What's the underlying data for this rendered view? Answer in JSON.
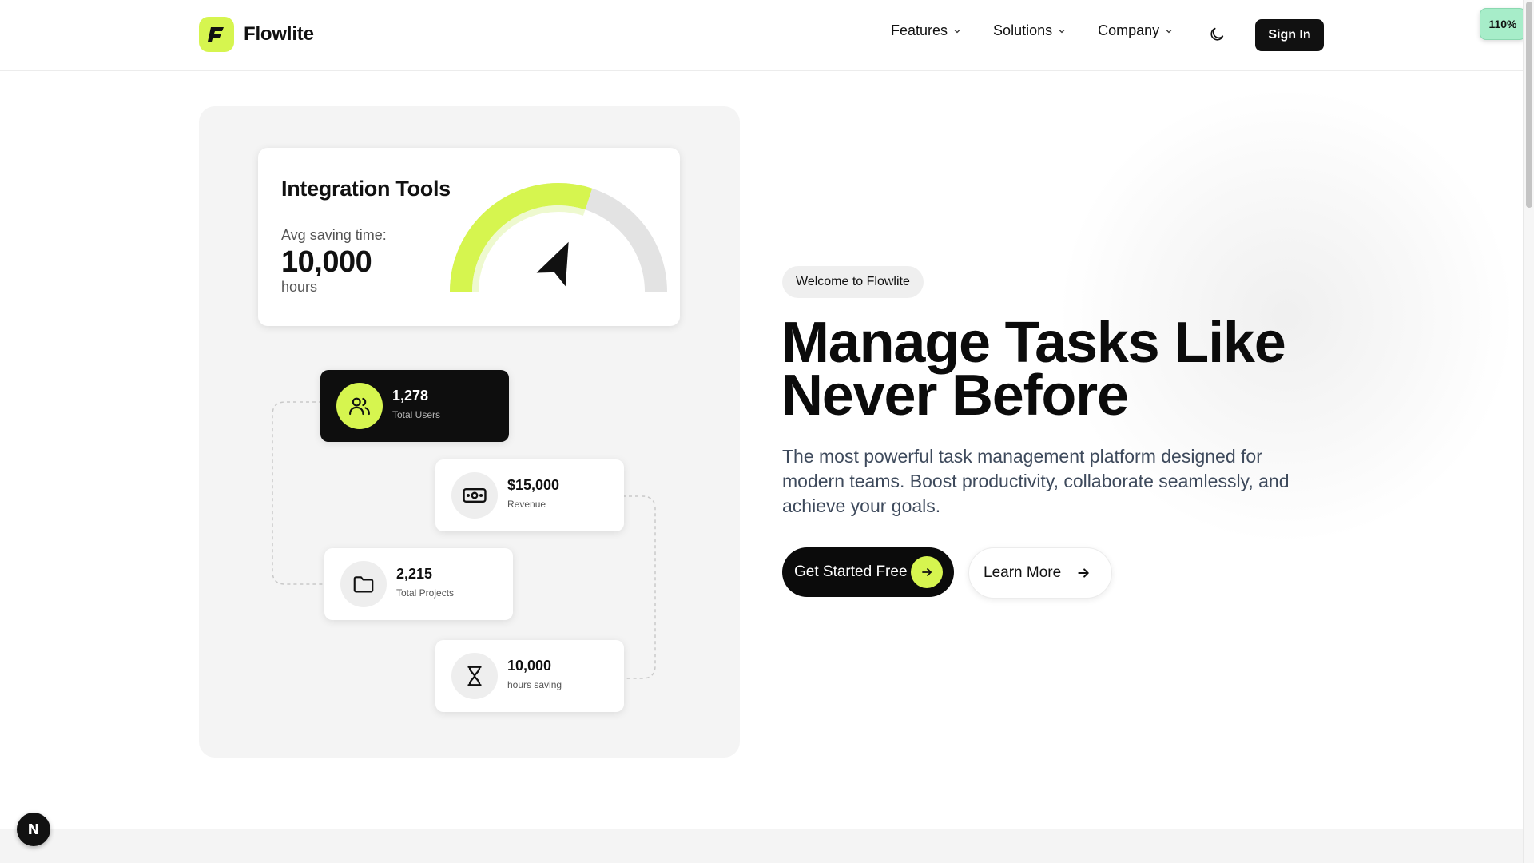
{
  "brand": {
    "name": "Flowlite",
    "accent": "#d6f54f",
    "logo_icon": "flowlite-logo-icon"
  },
  "nav": {
    "items": [
      {
        "label": "Features",
        "icon": "chevron-down-icon"
      },
      {
        "label": "Solutions",
        "icon": "chevron-down-icon"
      },
      {
        "label": "Company",
        "icon": "chevron-down-icon"
      }
    ],
    "theme_icon": "moon-icon",
    "signin_label": "Sign In"
  },
  "zoom_badge": "110%",
  "integration": {
    "title": "Integration Tools",
    "subtitle": "Avg saving time:",
    "value": "10,000",
    "unit": "hours",
    "gauge_fill": 0.6,
    "gauge_icon": "navigation-arrow-icon"
  },
  "stats": [
    {
      "value": "1,278",
      "label": "Total Users",
      "icon": "users-icon",
      "style": "dark"
    },
    {
      "value": "$15,000",
      "label": "Revenue",
      "icon": "banknote-icon",
      "style": "light"
    },
    {
      "value": "2,215",
      "label": "Total Projects",
      "icon": "folder-icon",
      "style": "light"
    },
    {
      "value": "10,000",
      "label": "hours saving",
      "icon": "hourglass-icon",
      "style": "light"
    }
  ],
  "hero": {
    "badge": "Welcome to Flowlite",
    "headline": "Manage Tasks Like Never Before",
    "subtext": "The most powerful task management platform designed for modern teams. Boost productivity, collaborate seamlessly, and achieve your goals.",
    "primary_cta": "Get Started Free",
    "secondary_cta": "Learn More"
  },
  "dev_badge": "N"
}
